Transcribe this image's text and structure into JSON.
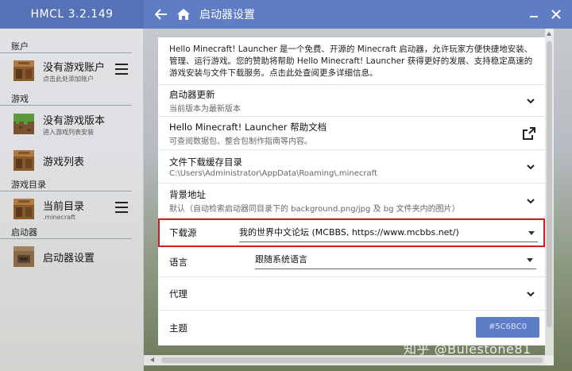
{
  "app": {
    "title": "HMCL 3.2.149"
  },
  "header": {
    "title": "启动器设置"
  },
  "sidebar": {
    "sections": [
      {
        "title": "账户",
        "items": [
          {
            "label": "没有游戏账户",
            "sub": "点击此处添加账户",
            "icon": "crafting-table-icon",
            "has_menu": true
          }
        ]
      },
      {
        "title": "游戏",
        "items": [
          {
            "label": "没有游戏版本",
            "sub": "进入游戏列表安装",
            "icon": "grass-block-icon",
            "has_menu": false
          },
          {
            "label": "游戏列表",
            "sub": "",
            "icon": "crafting-table-icon",
            "has_menu": false
          }
        ]
      },
      {
        "title": "游戏目录",
        "items": [
          {
            "label": "当前目录",
            "sub": ".minecraft",
            "icon": "crafting-table-icon",
            "has_menu": true
          }
        ]
      },
      {
        "title": "启动器",
        "items": [
          {
            "label": "启动器设置",
            "sub": "",
            "icon": "furnace-icon",
            "has_menu": false
          }
        ]
      }
    ]
  },
  "main": {
    "intro": "Hello Minecraft! Launcher 是一个免费、开源的 Minecraft 启动器，允许玩家方便快捷地安装、管理、运行游戏。您的赞助将帮助 Hello Minecraft! Launcher 获得更好的发展、支持稳定高速的游戏安装与文件下载服务。点击此处查阅更多详细信息。",
    "update": {
      "title": "启动器更新",
      "sub": "当前版本为最新版本"
    },
    "help": {
      "title": "Hello Minecraft! Launcher 帮助文档",
      "sub": "可查阅数据包、整合包制作指南等内容。"
    },
    "cache": {
      "title": "文件下载缓存目录",
      "sub": "C:\\Users\\Administrator\\AppData\\Roaming\\.minecraft"
    },
    "background": {
      "title": "背景地址",
      "sub": "默认（自动检索启动器同目录下的 background.png/jpg 及 bg 文件夹内的图片）"
    },
    "download_source": {
      "label": "下载源",
      "value": "我的世界中文论坛 (MCBBS, https://www.mcbbs.net/)"
    },
    "language": {
      "label": "语言",
      "value": "跟随系统语言"
    },
    "proxy": {
      "label": "代理"
    },
    "theme": {
      "label": "主题",
      "color_value": "#5C6BC0",
      "color": "#5d7ec6"
    }
  },
  "watermark": "知乎 @Bulestone81",
  "colors": {
    "titlebar": "#5e7dc4",
    "titlebar_left": "#5472b5",
    "highlight_border": "#d21e1e"
  }
}
